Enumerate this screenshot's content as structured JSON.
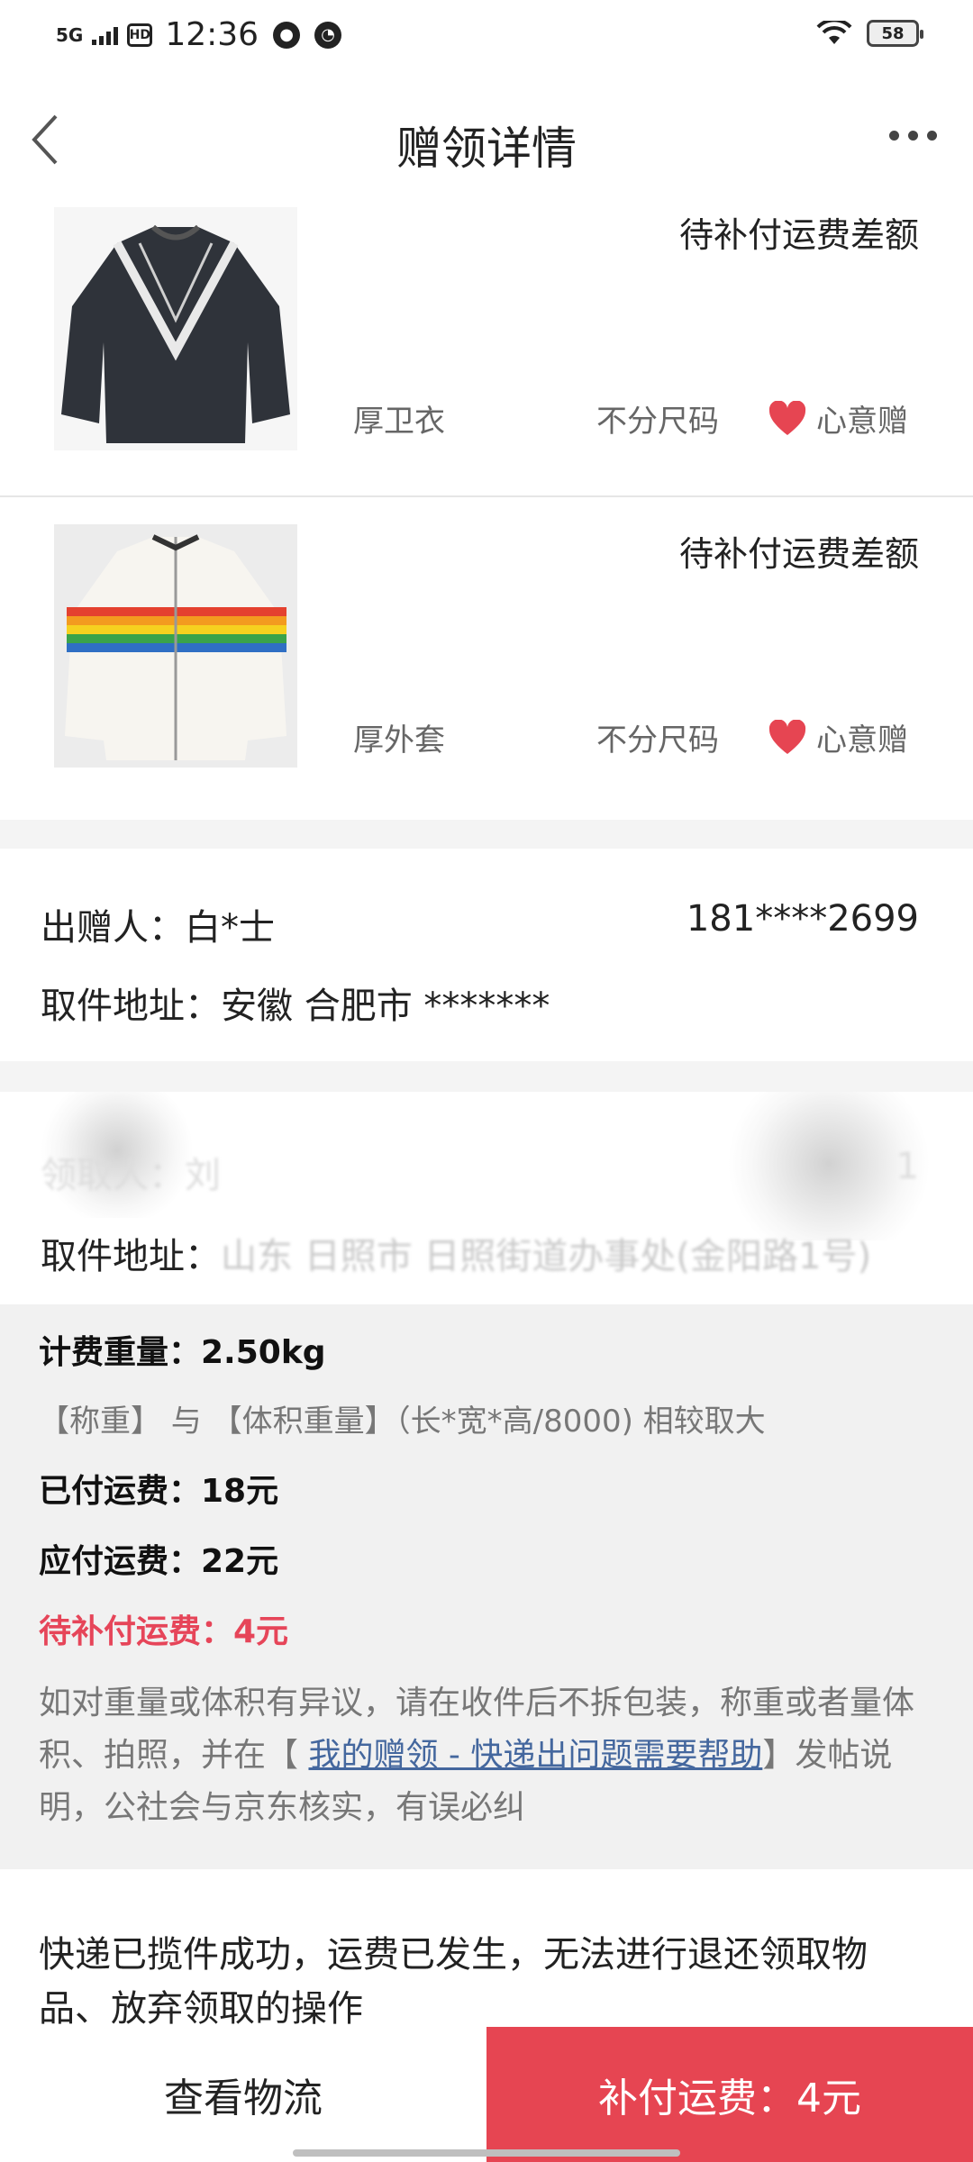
{
  "status_bar": {
    "network": "5G",
    "hd": "HD",
    "time": "12:36",
    "battery": "58"
  },
  "header": {
    "title": "赠领详情"
  },
  "items": [
    {
      "status": "待补付运费差额",
      "name": "厚卫衣",
      "size": "不分尺码",
      "type": "心意赠"
    },
    {
      "status": "待补付运费差额",
      "name": "厚外套",
      "size": "不分尺码",
      "type": "心意赠"
    }
  ],
  "giver": {
    "name_label": "出赠人：白*士",
    "phone": "181****2699",
    "address_label": "取件地址：",
    "address_value": "安徽 合肥市 *******"
  },
  "receiver": {
    "name_label": "领取人：刘",
    "phone": "1",
    "address_label": "取件地址：",
    "address_value": "山东 日照市 日照街道办事处(金阳路1号)"
  },
  "fee": {
    "billing_weight": "计费重量：2.50kg",
    "weight_rule": "【称重】 与 【体积重量】（长*宽*高/8000) 相较取大",
    "paid": "已付运费：18元",
    "payable": "应付运费：22元",
    "pending": "待补付运费：4元",
    "note_before": "如对重量或体积有异议，请在收件后不拆包装，称重或者量体积、拍照，并在【 ",
    "note_link": "我的赠领 - 快递出问题需要帮助",
    "note_after": "】发帖说明，公社会与京东核实，有误必纠"
  },
  "notice": "快递已揽件成功，运费已发生，无法进行退还领取物品、放弃领取的操作",
  "actions": {
    "logistics": "查看物流",
    "pay": "补付运费：4元"
  },
  "colors": {
    "accent": "#e64552",
    "link": "#44679e",
    "panel": "#f1f1f1"
  }
}
